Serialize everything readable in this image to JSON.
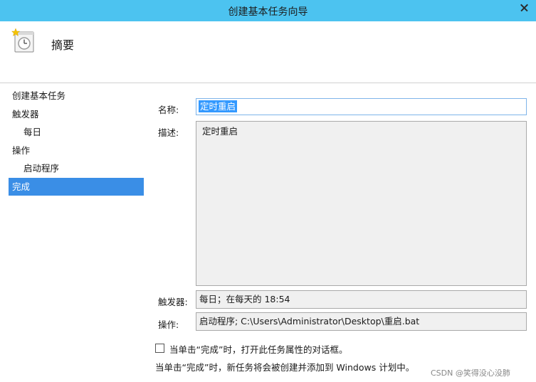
{
  "window": {
    "title": "创建基本任务向导"
  },
  "header": {
    "title": "摘要",
    "icon": "task-clock-icon"
  },
  "steps": [
    {
      "label": "创建基本任务",
      "level": 0,
      "active": false
    },
    {
      "label": "触发器",
      "level": 0,
      "active": false
    },
    {
      "label": "每日",
      "level": 1,
      "active": false
    },
    {
      "label": "操作",
      "level": 0,
      "active": false
    },
    {
      "label": "启动程序",
      "level": 1,
      "active": false
    },
    {
      "label": "完成",
      "level": 0,
      "active": true
    }
  ],
  "form": {
    "name_label": "名称:",
    "name_value": "定时重启",
    "desc_label": "描述:",
    "desc_value": "定时重启",
    "trigger_label": "触发器:",
    "trigger_value": "每日；在每天的 18:54",
    "action_label": "操作:",
    "action_value": "启动程序; C:\\Users\\Administrator\\Desktop\\重启.bat"
  },
  "footer": {
    "checkbox_label": "当单击“完成”时，打开此任务属性的对话框。",
    "checkbox_checked": false,
    "note": "当单击“完成”时，新任务将会被创建并添加到 Windows 计划中。"
  },
  "watermark": "CSDN @笑得没心没肺",
  "colors": {
    "titlebar": "#4cc3f0",
    "selected": "#3a8ee6"
  }
}
